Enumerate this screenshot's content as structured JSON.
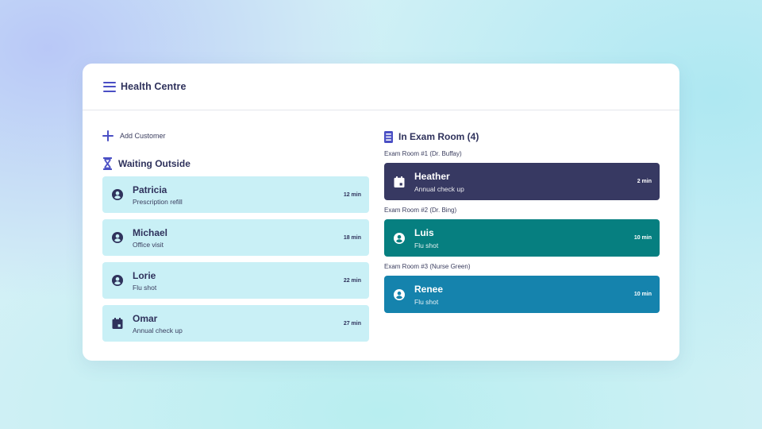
{
  "app": {
    "title": "Health Centre",
    "icon": "menu-icon"
  },
  "colors": {
    "accent": "#4a4fc4",
    "waiting_card": "#c9f0f6",
    "room_1": "#373962",
    "room_2": "#067f80",
    "room_3": "#1583ad"
  },
  "waiting": {
    "add_label": "Add Customer",
    "title": "Waiting Outside",
    "title_icon": "hourglass-icon",
    "customers": [
      {
        "name": "Patricia",
        "reason": "Prescription refill",
        "time": "12 min",
        "icon": "user-icon"
      },
      {
        "name": "Michael",
        "reason": "Office visit",
        "time": "18 min",
        "icon": "user-icon"
      },
      {
        "name": "Lorie",
        "reason": "Flu shot",
        "time": "22 min",
        "icon": "user-icon"
      },
      {
        "name": "Omar",
        "reason": "Annual check up",
        "time": "27 min",
        "icon": "calendar-icon"
      }
    ]
  },
  "exam": {
    "title": "In Exam Room (4)",
    "title_icon": "clipboard-icon",
    "rooms": [
      {
        "label": "Exam Room #1 (Dr. Buffay)",
        "name": "Heather",
        "reason": "Annual check up",
        "time": "2 min",
        "icon": "calendar-icon"
      },
      {
        "label": "Exam Room #2 (Dr. Bing)",
        "name": "Luis",
        "reason": "Flu shot",
        "time": "10 min",
        "icon": "user-icon"
      },
      {
        "label": "Exam Room #3 (Nurse Green)",
        "name": "Renee",
        "reason": "Flu shot",
        "time": "10 min",
        "icon": "user-icon"
      }
    ]
  }
}
